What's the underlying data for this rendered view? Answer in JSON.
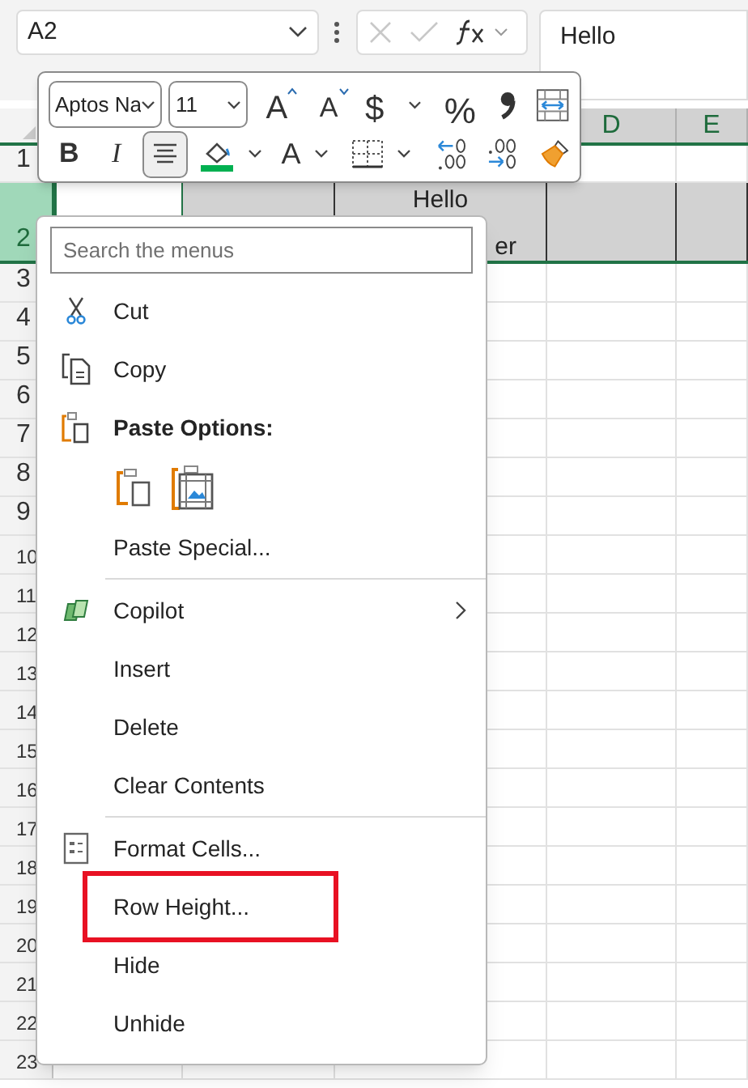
{
  "formula_bar": {
    "name_box": "A2",
    "formula": "Hello"
  },
  "sheet": {
    "column_headers": [
      "D",
      "E"
    ],
    "rows": [
      {
        "header": "1",
        "selected": false
      },
      {
        "header": "2",
        "selected": true
      },
      {
        "header": "3",
        "selected": false
      },
      {
        "header": "4",
        "selected": false
      },
      {
        "header": "5",
        "selected": false
      },
      {
        "header": "6",
        "selected": false
      },
      {
        "header": "7",
        "selected": false
      },
      {
        "header": "8",
        "selected": false
      },
      {
        "header": "9",
        "selected": false
      },
      {
        "header": "10",
        "selected": false
      },
      {
        "header": "11",
        "selected": false
      },
      {
        "header": "12",
        "selected": false
      },
      {
        "header": "13",
        "selected": false
      },
      {
        "header": "14",
        "selected": false
      },
      {
        "header": "15",
        "selected": false
      },
      {
        "header": "16",
        "selected": false
      },
      {
        "header": "17",
        "selected": false
      },
      {
        "header": "18",
        "selected": false
      },
      {
        "header": "19",
        "selected": false
      },
      {
        "header": "20",
        "selected": false
      },
      {
        "header": "21",
        "selected": false
      },
      {
        "header": "22",
        "selected": false
      },
      {
        "header": "23",
        "selected": false
      }
    ],
    "cell_c2_lines": [
      "Hello",
      "er"
    ]
  },
  "mini_toolbar": {
    "font": "Aptos Na",
    "size": "11",
    "row_1": [
      {
        "kind": "grow_font",
        "text": "A"
      },
      {
        "kind": "shrink_font",
        "text": "A"
      },
      {
        "kind": "currency",
        "text": "$"
      },
      {
        "kind": "percent",
        "text": "%"
      },
      {
        "kind": "comma"
      },
      {
        "kind": "wrap"
      }
    ],
    "row_2": [
      {
        "kind": "bold",
        "text": "B",
        "selected": false
      },
      {
        "kind": "italic",
        "text": "I",
        "selected": false
      },
      {
        "kind": "align_center",
        "selected": true
      },
      {
        "kind": "fill_color"
      },
      {
        "kind": "font_color",
        "text": "A"
      },
      {
        "kind": "borders"
      },
      {
        "kind": "increase_decimal"
      },
      {
        "kind": "decrease_decimal"
      },
      {
        "kind": "format_painter"
      }
    ]
  },
  "context_menu": {
    "search_placeholder": "Search the menus",
    "items": [
      {
        "kind": "item",
        "label": "Cut",
        "framed": false
      },
      {
        "kind": "item",
        "label": "Copy",
        "framed": false
      },
      {
        "kind": "heading",
        "label": "Paste Options:"
      },
      {
        "kind": "paste_buttons"
      },
      {
        "kind": "item",
        "label": "Paste Special...",
        "framed": false
      },
      {
        "kind": "separator"
      },
      {
        "kind": "item",
        "label": "Copilot",
        "submenu": true,
        "framed": false
      },
      {
        "kind": "item",
        "label": "Insert",
        "framed": false
      },
      {
        "kind": "item",
        "label": "Delete",
        "framed": false
      },
      {
        "kind": "item",
        "label": "Clear Contents",
        "framed": false
      },
      {
        "kind": "separator"
      },
      {
        "kind": "item",
        "label": "Format Cells...",
        "framed": false
      },
      {
        "kind": "item",
        "label": "Row Height...",
        "framed": true
      },
      {
        "kind": "item",
        "label": "Hide",
        "framed": false
      },
      {
        "kind": "item",
        "label": "Unhide",
        "framed": false
      }
    ]
  }
}
